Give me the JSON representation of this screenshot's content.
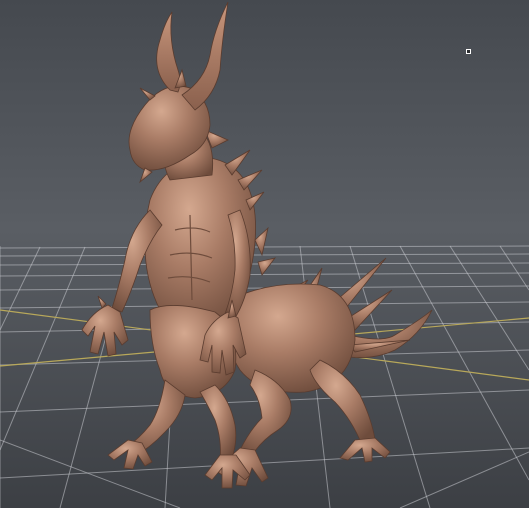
{
  "viewport": {
    "label": "",
    "background_top": "#45494f",
    "background_bottom": "#3c3f44",
    "grid_color": "#c9cbd0",
    "axis_color": "#b8a85a",
    "model_color": "#a97c66",
    "marker_icon": "square-vertex-marker"
  }
}
